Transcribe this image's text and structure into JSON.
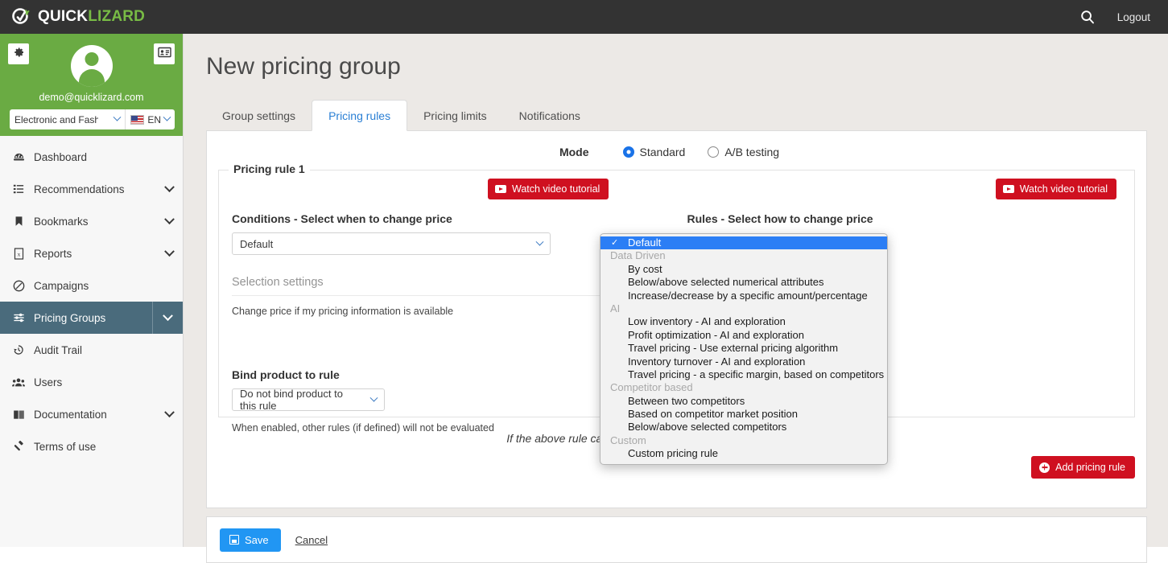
{
  "topbar": {
    "brand_prefix": "QUICK",
    "brand_suffix": "LIZARD",
    "search_icon": "search-icon",
    "logout_label": "Logout"
  },
  "sidebar": {
    "gear_icon": "gear-icon",
    "card_icon": "id-card-icon",
    "avatar_icon": "avatar-icon",
    "email": "demo@quicklizard.com",
    "shop_select": "Electronic and Fashi",
    "language": "EN",
    "flag_icon": "us-flag-icon",
    "items": [
      {
        "label": "Dashboard",
        "icon": "dashboard-icon",
        "caret": false,
        "active": false
      },
      {
        "label": "Recommendations",
        "icon": "list-icon",
        "caret": true,
        "active": false
      },
      {
        "label": "Bookmarks",
        "icon": "bookmark-icon",
        "caret": true,
        "active": false
      },
      {
        "label": "Reports",
        "icon": "report-icon",
        "caret": true,
        "active": false
      },
      {
        "label": "Campaigns",
        "icon": "campaign-icon",
        "caret": false,
        "active": false
      },
      {
        "label": "Pricing Groups",
        "icon": "sliders-icon",
        "caret": true,
        "active": true
      },
      {
        "label": "Audit Trail",
        "icon": "history-icon",
        "caret": false,
        "active": false
      },
      {
        "label": "Users",
        "icon": "users-icon",
        "caret": false,
        "active": false
      },
      {
        "label": "Documentation",
        "icon": "book-icon",
        "caret": true,
        "active": false
      },
      {
        "label": "Terms of use",
        "icon": "gavel-icon",
        "caret": false,
        "active": false
      }
    ]
  },
  "main": {
    "page_title": "New pricing group",
    "tabs": [
      {
        "label": "Group settings",
        "active": false
      },
      {
        "label": "Pricing rules",
        "active": true
      },
      {
        "label": "Pricing limits",
        "active": false
      },
      {
        "label": "Notifications",
        "active": false
      }
    ],
    "mode": {
      "label": "Mode",
      "options": [
        {
          "label": "Standard",
          "selected": true
        },
        {
          "label": "A/B testing",
          "selected": false
        }
      ]
    },
    "rule": {
      "legend": "Pricing rule 1",
      "video_button": "Watch video tutorial",
      "conditions_title": "Conditions - Select when to change price",
      "conditions_value": "Default",
      "selection_settings_title": "Selection settings",
      "selection_settings_note": "Change price if my pricing information is available",
      "bind_title": "Bind product to rule",
      "bind_value": "Do not bind product to this rule",
      "bind_note": "When enabled, other rules (if defined) will not be evaluated",
      "rules_title": "Rules - Select how to change price"
    },
    "fallback_text": "If the above rule cannot be processed, the next rule will set the price",
    "add_rule_button": "Add pricing rule"
  },
  "footer": {
    "save_label": "Save",
    "save_icon": "save-disk-icon",
    "cancel_label": "Cancel"
  },
  "dropdown": {
    "entries": [
      {
        "kind": "item",
        "label": "Default",
        "selected": true
      },
      {
        "kind": "group",
        "label": "Data Driven"
      },
      {
        "kind": "item",
        "label": "By cost",
        "selected": false
      },
      {
        "kind": "item",
        "label": "Below/above selected numerical attributes",
        "selected": false
      },
      {
        "kind": "item",
        "label": "Increase/decrease by a specific amount/percentage",
        "selected": false
      },
      {
        "kind": "group",
        "label": "AI"
      },
      {
        "kind": "item",
        "label": "Low inventory - AI and exploration",
        "selected": false
      },
      {
        "kind": "item",
        "label": "Profit optimization - AI and exploration",
        "selected": false
      },
      {
        "kind": "item",
        "label": "Travel pricing - Use external pricing algorithm",
        "selected": false
      },
      {
        "kind": "item",
        "label": "Inventory turnover - AI and exploration",
        "selected": false
      },
      {
        "kind": "item",
        "label": "Travel pricing - a specific margin, based on competitors",
        "selected": false
      },
      {
        "kind": "group",
        "label": "Competitor based"
      },
      {
        "kind": "item",
        "label": "Between two competitors",
        "selected": false
      },
      {
        "kind": "item",
        "label": "Based on competitor market position",
        "selected": false
      },
      {
        "kind": "item",
        "label": "Below/above selected competitors",
        "selected": false
      },
      {
        "kind": "group",
        "label": "Custom"
      },
      {
        "kind": "item",
        "label": "Custom pricing rule",
        "selected": false
      }
    ]
  },
  "colors": {
    "brand_green": "#6aab43",
    "topbar_dark": "#333333",
    "active_nav": "#4a6b7c",
    "accent_blue": "#2a7fd4",
    "video_red": "#cf1020",
    "save_blue": "#2196f3",
    "dropdown_select": "#2b7ef5"
  }
}
